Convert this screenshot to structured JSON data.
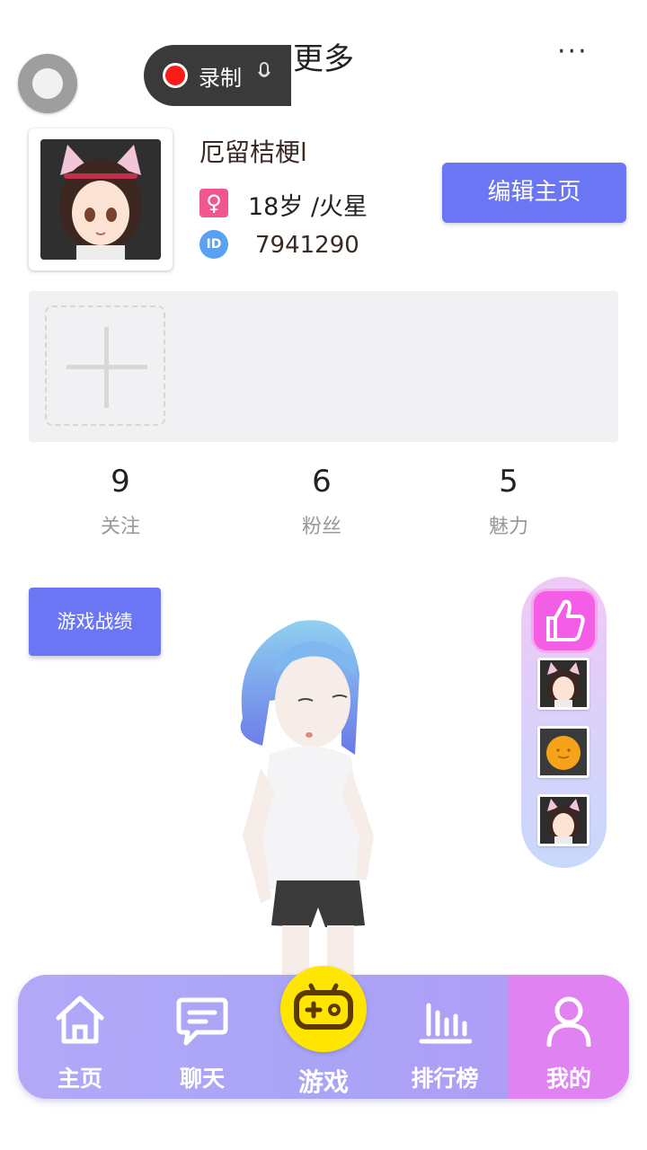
{
  "topbar": {
    "record_label": "录制",
    "title": "更多",
    "more": "···"
  },
  "profile": {
    "nickname": "厄留桔梗l",
    "age_location": "18岁 /火星",
    "id_badge": "ID",
    "user_id": "7941290",
    "edit_button": "编辑主页",
    "gender_symbol": "♀"
  },
  "stats": [
    {
      "value": "9",
      "label": "关注"
    },
    {
      "value": "6",
      "label": "粉丝"
    },
    {
      "value": "5",
      "label": "魅力"
    }
  ],
  "actions": {
    "game_record": "游戏战绩"
  },
  "nav": {
    "items": [
      {
        "label": "主页",
        "icon": "home-icon"
      },
      {
        "label": "聊天",
        "icon": "chat-icon"
      },
      {
        "label": "游戏",
        "icon": "gamepad-icon"
      },
      {
        "label": "排行榜",
        "icon": "ranking-icon"
      },
      {
        "label": "我的",
        "icon": "user-icon"
      }
    ],
    "active": "我的"
  },
  "colors": {
    "accent": "#6b76f4",
    "nav_bg": "#aea6f7",
    "nav_active": "#e182f2",
    "game_yellow": "#ffe600",
    "like_pink": "#f45ee6"
  }
}
